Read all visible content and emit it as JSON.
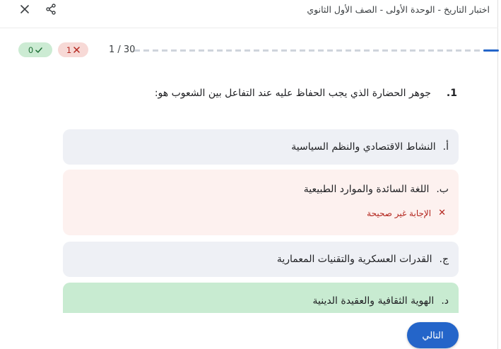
{
  "header": {
    "title": "اختبار التاريخ - الوحدة الأولى - الصف الأول الثانوي"
  },
  "score": {
    "correct": "0",
    "wrong": "1"
  },
  "progress": {
    "label": "1 / 30",
    "fraction": 0.033
  },
  "question": {
    "number": "1.",
    "text": "جوهر الحضارة الذي يجب الحفاظ عليه عند التفاعل بين الشعوب هو:"
  },
  "options": [
    {
      "letter": "أ.",
      "text": "النشاط الاقتصادي والنظم السياسية",
      "state": "neutral"
    },
    {
      "letter": "ب.",
      "text": "اللغة السائدة والموارد الطبيعية",
      "state": "incorrect",
      "feedback": "الإجابة غير صحيحة"
    },
    {
      "letter": "ج.",
      "text": "القدرات العسكرية والتقنيات المعمارية",
      "state": "neutral"
    },
    {
      "letter": "د.",
      "text": "الهوية الثقافية والعقيدة الدينية",
      "state": "correct"
    }
  ],
  "next_button": {
    "label": "التالي"
  },
  "colors": {
    "accent": "#2465c9",
    "correct_bg": "#c8ebd1",
    "incorrect_bg": "#fdf1ef",
    "neutral_bg": "#eef0f5",
    "error_text": "#b3261e"
  },
  "icons": {
    "close": "close-icon",
    "share": "share-icon",
    "check": "check-icon",
    "cross": "cross-icon"
  }
}
